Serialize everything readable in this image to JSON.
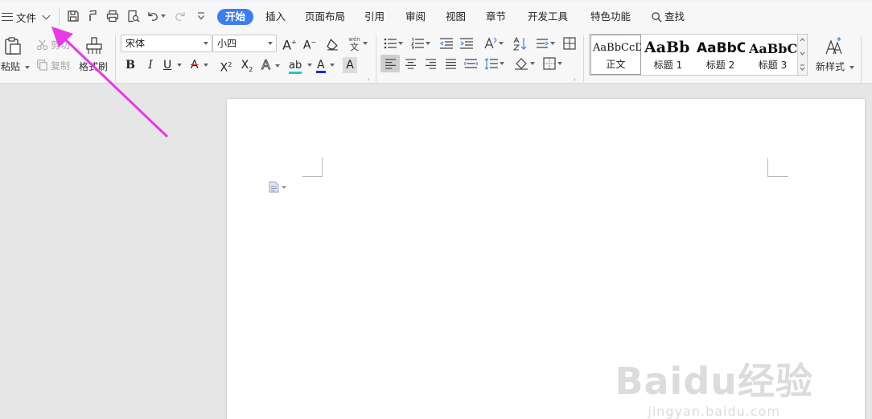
{
  "topbar": {
    "file_label": "文件",
    "tabs": [
      {
        "label": "开始",
        "active": true
      },
      {
        "label": "插入"
      },
      {
        "label": "页面布局"
      },
      {
        "label": "引用"
      },
      {
        "label": "审阅"
      },
      {
        "label": "视图"
      },
      {
        "label": "章节"
      },
      {
        "label": "开发工具"
      },
      {
        "label": "特色功能"
      }
    ],
    "search_label": "查找",
    "quick_access": [
      "save-icon",
      "format-painter-quick-icon",
      "print-icon",
      "print-preview-icon",
      "undo-icon",
      "redo-icon",
      "customize-quick-access-icon"
    ]
  },
  "ribbon": {
    "clipboard": {
      "paste": "粘贴",
      "cut": "剪切",
      "copy": "复制",
      "format_painter": "格式刷"
    },
    "font": {
      "family": "宋体",
      "size": "小四",
      "grow_glyph": "A",
      "shrink_glyph": "A",
      "bold": "B",
      "italic": "I",
      "underline": "U",
      "strike": "A",
      "superscript": "X",
      "subscript": "X",
      "effect": "A",
      "highlight": "ab",
      "color": "A",
      "shading": "A",
      "phonetic": "wén"
    },
    "styles": [
      {
        "preview": "AaBbCcDd",
        "label": "正文",
        "selected": true
      },
      {
        "preview": "AaBb",
        "label": "标题 1"
      },
      {
        "preview": "AaBbC",
        "label": "标题 2"
      },
      {
        "preview": "AaBbC",
        "label": "标题 3"
      }
    ],
    "new_style": "新样式"
  },
  "watermark": {
    "main": "Baidu经验",
    "sub": "jingyan.baidu.com"
  },
  "colors": {
    "accent": "#3c7ef0",
    "annotation_arrow": "#e838e8",
    "font_color_bar": "#1a2fd0",
    "highlight_bar": "#22c7c7"
  }
}
